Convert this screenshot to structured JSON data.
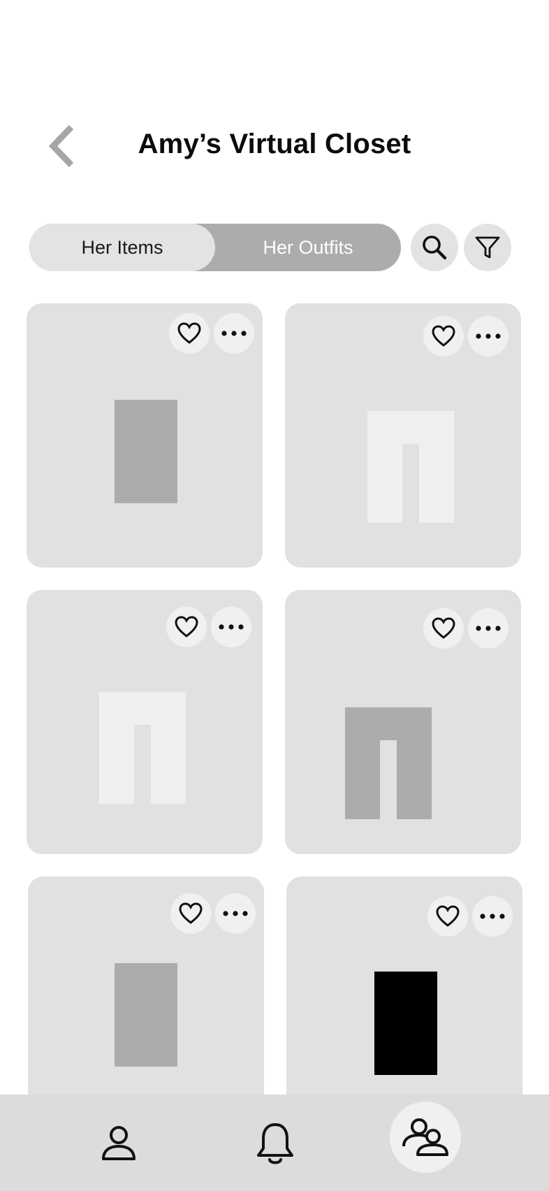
{
  "header": {
    "title": "Amy’s Virtual Closet",
    "back_icon": "chevron-left-icon"
  },
  "tabs": [
    {
      "label": "Her Items",
      "active": true
    },
    {
      "label": "Her Outfits",
      "active": false
    }
  ],
  "toolbar": {
    "search_icon": "search-icon",
    "filter_icon": "filter-icon"
  },
  "items": [
    {
      "placeholder": "top",
      "color": "#acacac"
    },
    {
      "placeholder": "pants",
      "color": "#f0f0f0"
    },
    {
      "placeholder": "pants",
      "color": "#f0f0f0"
    },
    {
      "placeholder": "pants",
      "color": "#acacac"
    },
    {
      "placeholder": "top",
      "color": "#acacac"
    },
    {
      "placeholder": "top",
      "color": "#000000"
    }
  ],
  "bottom_nav": [
    {
      "icon": "profile-icon",
      "active": false
    },
    {
      "icon": "bell-icon",
      "active": false
    },
    {
      "icon": "friends-icon",
      "active": true
    }
  ],
  "colors": {
    "card_bg": "#e1e1e1",
    "tab_active_bg": "#e3e3e3",
    "tab_inactive_bg": "#acacac",
    "nav_bg": "#dcdcdc",
    "icon_button_bg": "#f0f0f0"
  }
}
